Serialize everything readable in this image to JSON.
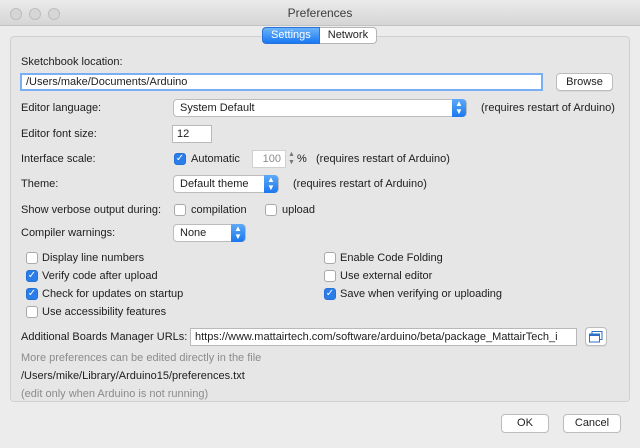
{
  "window": {
    "title": "Preferences"
  },
  "tabs": [
    {
      "label": "Settings",
      "active": true
    },
    {
      "label": "Network",
      "active": false
    }
  ],
  "sketchbook": {
    "label": "Sketchbook location:",
    "path": "/Users/make/Documents/Arduino",
    "browse_label": "Browse"
  },
  "editor_language": {
    "label": "Editor language:",
    "value": "System Default",
    "note": "(requires restart of Arduino)"
  },
  "font_size": {
    "label": "Editor font size:",
    "value": "12"
  },
  "interface_scale": {
    "label": "Interface scale:",
    "automatic_label": "Automatic",
    "automatic_checked": true,
    "value": "100",
    "unit": "%",
    "note": "(requires restart of Arduino)"
  },
  "theme": {
    "label": "Theme:",
    "value": "Default theme",
    "note": "(requires restart of Arduino)"
  },
  "verbose": {
    "label": "Show verbose output during:",
    "compilation_label": "compilation",
    "compilation_checked": false,
    "upload_label": "upload",
    "upload_checked": false
  },
  "compiler_warnings": {
    "label": "Compiler warnings:",
    "value": "None"
  },
  "options_left": [
    {
      "label": "Display line numbers",
      "checked": false
    },
    {
      "label": "Verify code after upload",
      "checked": true
    },
    {
      "label": "Check for updates on startup",
      "checked": true
    },
    {
      "label": "Use accessibility features",
      "checked": false
    }
  ],
  "options_right": [
    {
      "label": "Enable Code Folding",
      "checked": false
    },
    {
      "label": "Use external editor",
      "checked": false
    },
    {
      "label": "Save when verifying or uploading",
      "checked": true
    }
  ],
  "boards_manager": {
    "label": "Additional Boards Manager URLs:",
    "value": "https://www.mattairtech.com/software/arduino/beta/package_MattairTech_i"
  },
  "more_prefs": {
    "line1": "More preferences can be edited directly in the file",
    "path": "/Users/mike/Library/Arduino15/preferences.txt",
    "line3": "(edit only when Arduino is not running)"
  },
  "footer": {
    "ok_label": "OK",
    "cancel_label": "Cancel"
  },
  "colors": {
    "accent": "#1979f3",
    "checkbox_on": "#2b7de9"
  },
  "icons": {
    "traffic_lights": [
      "close-icon",
      "minimize-icon",
      "zoom-icon"
    ],
    "url_editor": "window-edit-icon",
    "popup_arrows": "chevron-updown-icon"
  }
}
